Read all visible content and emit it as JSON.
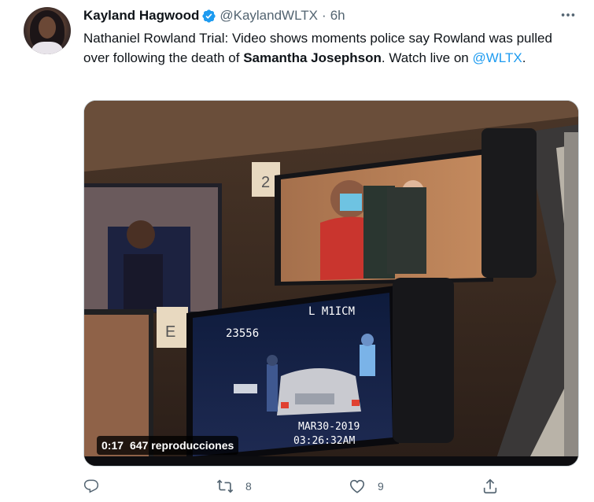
{
  "author": {
    "name": "Kayland Hagwood",
    "handle": "@KaylandWLTX",
    "separator": "·",
    "time": "6h",
    "verified": true
  },
  "tweet": {
    "text_part1": "Nathaniel Rowland Trial: Video shows moments police say Rowland was pulled over following the death of ",
    "text_bold": "Samantha Josephson",
    "text_part2": ". Watch live on ",
    "text_link": "@WLTX",
    "text_end": "."
  },
  "media": {
    "duration": "0:17",
    "views": "647 reproducciones",
    "overlay_text": {
      "sheet_top": "2",
      "sheet_bottom": "E",
      "dashcam_unit": "L M1ICM",
      "dashcam_number": "23556",
      "dashcam_date": "MAR30-2019",
      "dashcam_clock": "03:26:32AM"
    }
  },
  "actions": {
    "reply_count": "",
    "retweet_count": "8",
    "like_count": "9"
  },
  "colors": {
    "link": "#1d9bf0",
    "secondary": "#536471",
    "verified": "#1d9bf0"
  },
  "icons": [
    "reply-icon",
    "retweet-icon",
    "like-icon",
    "share-icon",
    "verified-badge-icon",
    "more-icon"
  ]
}
